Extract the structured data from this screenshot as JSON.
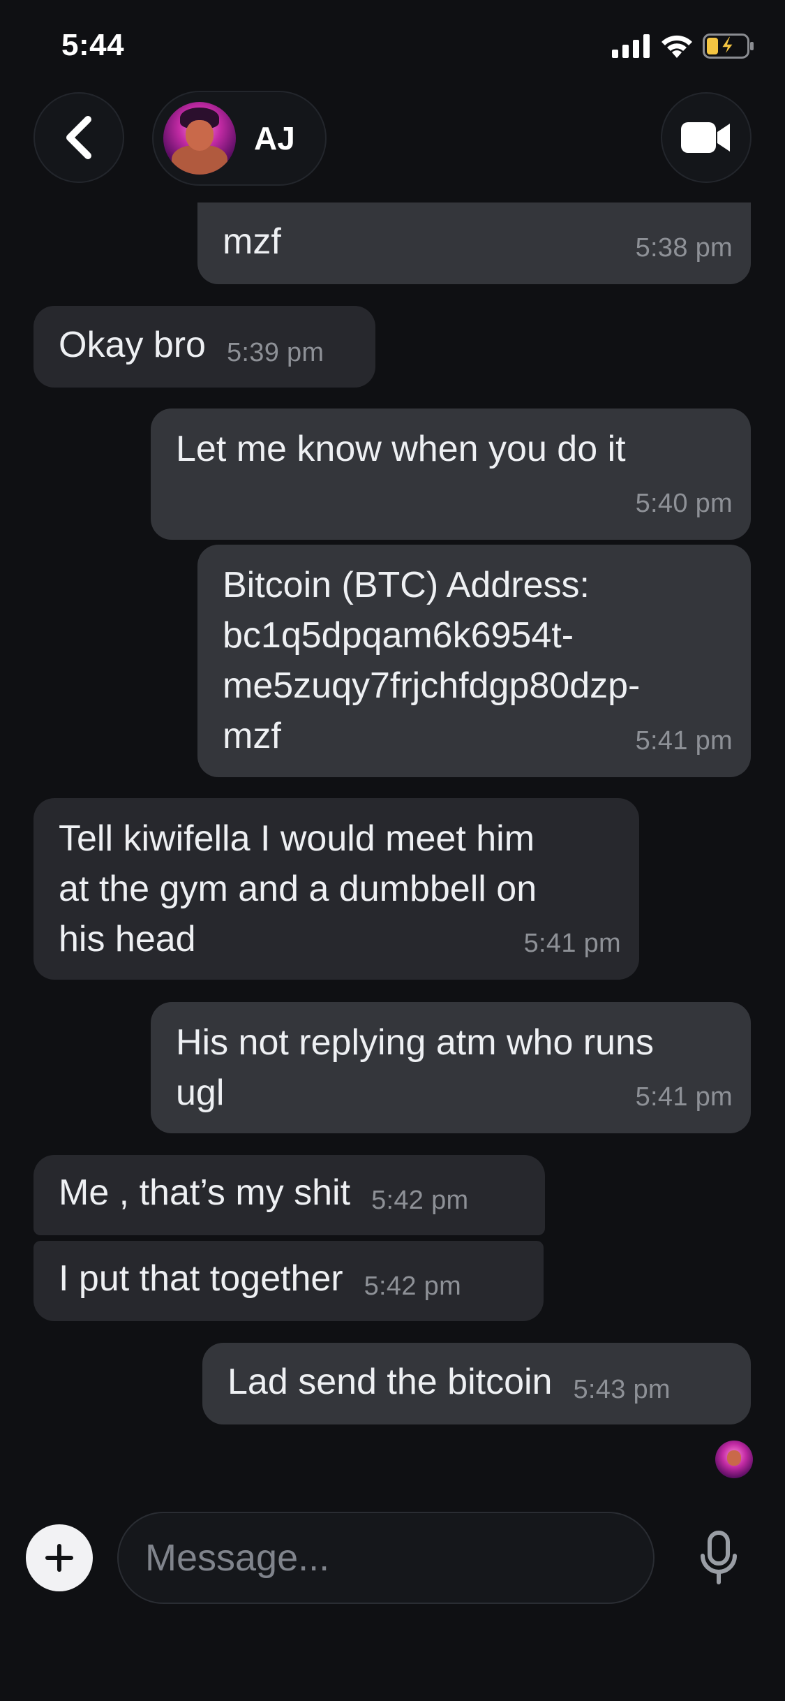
{
  "status_bar": {
    "time": "5:44",
    "icons": [
      "signal-icon",
      "wifi-icon",
      "battery-charging-icon"
    ],
    "battery_color": "#f4c542"
  },
  "header": {
    "back_icon": "chevron-left-icon",
    "contact_name": "AJ",
    "video_icon": "video-camera-icon"
  },
  "messages": [
    {
      "direction": "out",
      "partial": true,
      "text": "mzf",
      "time": "5:38 pm"
    },
    {
      "direction": "in",
      "text": "Okay bro",
      "time": "5:39 pm"
    },
    {
      "direction": "out",
      "text": "Let me know when you do it",
      "time": "5:40 pm"
    },
    {
      "direction": "out",
      "lines": [
        "Bitcoin (BTC) Address:",
        "bc1q5dpqam6k6954t-",
        "me5zuqy7frjchfdgp80dzp-",
        "mzf"
      ],
      "time": "5:41 pm"
    },
    {
      "direction": "in",
      "lines": [
        "Tell kiwifella I would meet him",
        "at the gym and a dumbbell on",
        "his head"
      ],
      "time": "5:41 pm"
    },
    {
      "direction": "out",
      "lines": [
        "His not replying atm who runs",
        "ugl"
      ],
      "time": "5:41 pm"
    },
    {
      "direction": "in",
      "text": "Me , that’s my shit",
      "time": "5:42 pm"
    },
    {
      "direction": "in",
      "text": "I put that together",
      "time": "5:42 pm"
    },
    {
      "direction": "out",
      "text": "Lad send the bitcoin",
      "time": "5:43 pm"
    }
  ],
  "composer": {
    "placeholder": "Message...",
    "plus_icon": "plus-icon",
    "mic_icon": "microphone-icon"
  },
  "colors": {
    "background": "#0f1013",
    "bubble_in": "#27282d",
    "bubble_out": "#34363b",
    "timestamp": "#8e9197"
  }
}
